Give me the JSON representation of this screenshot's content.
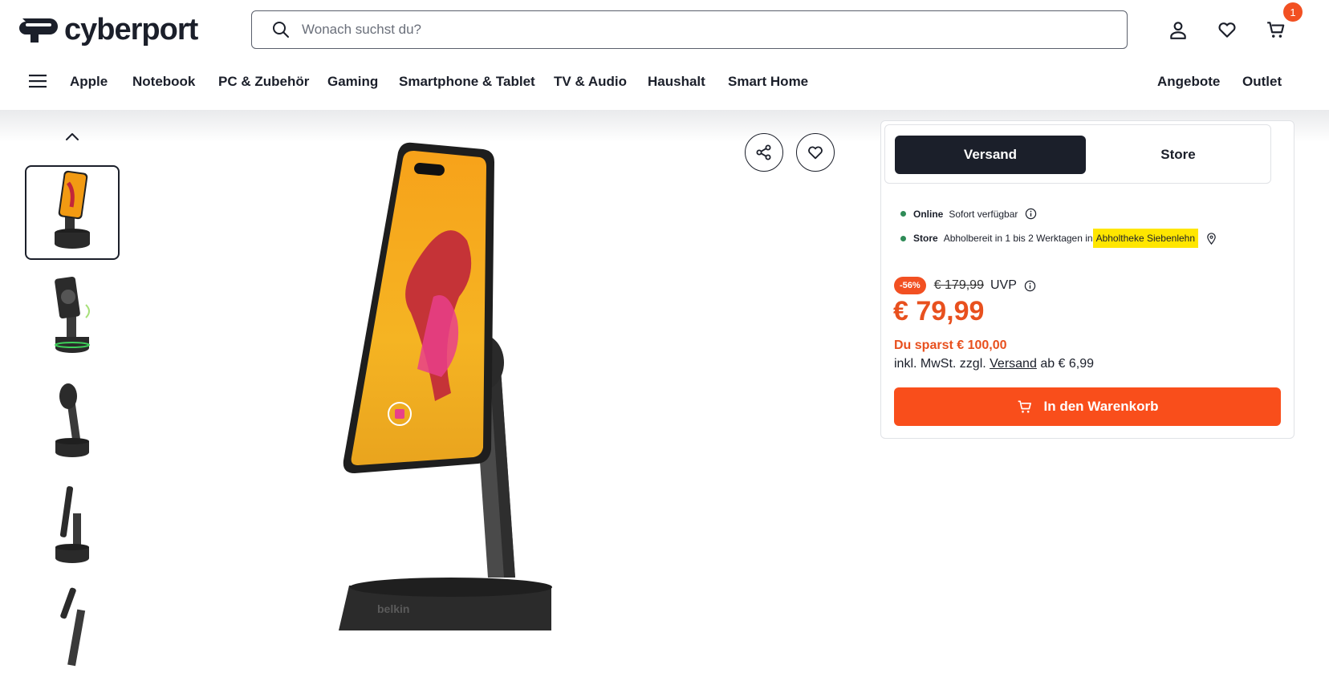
{
  "header": {
    "logo_text": "cyberport",
    "search_placeholder": "Wonach suchst du?",
    "cart_count": "1"
  },
  "nav": {
    "items": [
      "Apple",
      "Notebook",
      "PC & Zubehör",
      "Gaming",
      "Smartphone & Tablet",
      "TV & Audio",
      "Haushalt",
      "Smart Home"
    ],
    "right_items": [
      "Angebote",
      "Outlet"
    ]
  },
  "product": {
    "brand_on_image": "belkin"
  },
  "purchase": {
    "tabs": [
      "Versand",
      "Store"
    ],
    "online_label": "Online",
    "online_status": "Sofort verfügbar",
    "store_label": "Store",
    "store_status": "Abholbereit in 1 bis 2 Werktagen in",
    "store_location": "Abholtheke Siebenlehn",
    "discount_badge": "-56%",
    "old_price": "€ 179,99",
    "uvp_label": "UVP",
    "price": "€ 79,99",
    "savings": "Du sparst € 100,00",
    "tax_prefix": "inkl. MwSt. zzgl.",
    "tax_link": "Versand",
    "tax_suffix": "ab € 6,99",
    "add_to_cart": "In den Warenkorb"
  },
  "colors": {
    "brand_dark": "#1b1f2a",
    "accent_orange": "#f94e1b",
    "price_orange": "#e8501e",
    "highlight_yellow": "#ffe600",
    "available_green": "#2e8b57"
  }
}
